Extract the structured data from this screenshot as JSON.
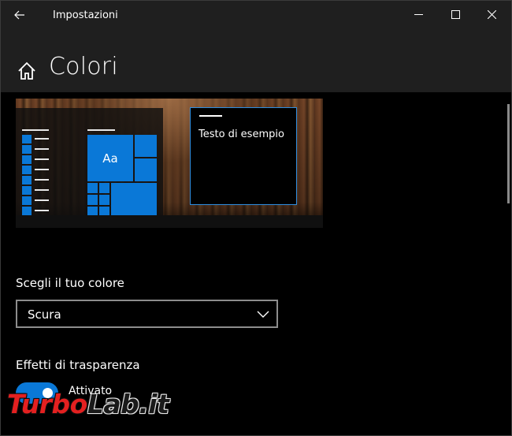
{
  "window": {
    "title": "Impostazioni",
    "controls": {
      "minimize_icon": "minimize-icon",
      "maximize_icon": "maximize-icon",
      "close_icon": "close-icon"
    },
    "back_icon": "back-arrow-icon"
  },
  "header": {
    "home_icon": "home-icon",
    "title": "Colori"
  },
  "preview": {
    "tile_label": "Aa",
    "sample_text": "Testo di esempio",
    "accent_color": "#0a78d7"
  },
  "color_choice": {
    "label": "Scegli il tuo colore",
    "selected": "Scura",
    "chevron_icon": "chevron-down-icon"
  },
  "transparency": {
    "label": "Effetti di trasparenza",
    "toggle_state": "Attivato",
    "toggle_on": true
  },
  "watermark": {
    "part1": "Turbo",
    "part2": "Lab.it"
  }
}
